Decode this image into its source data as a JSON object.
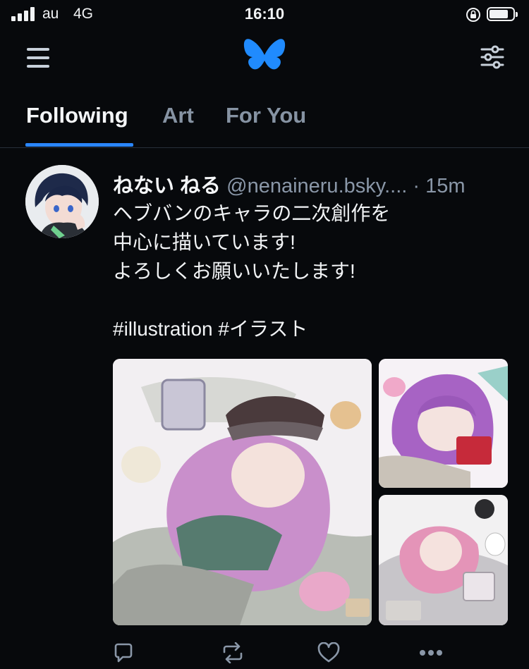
{
  "status_bar": {
    "carrier": "au",
    "network": "4G",
    "time": "16:10"
  },
  "header": {
    "logo_icon": "butterfly-logo-icon",
    "brand_color": "#208bfe"
  },
  "tabs": [
    {
      "label": "Following",
      "active": true
    },
    {
      "label": "Art",
      "active": false
    },
    {
      "label": "For You",
      "active": false
    }
  ],
  "post": {
    "author": "ねない ねる",
    "handle": "@nenaineru.bsky....",
    "separator": "·",
    "time": "15m",
    "text_lines": [
      "ヘブバンのキャラの二次創作を",
      "中心に描いています!",
      "よろしくお願いいたします!",
      "",
      "#illustration #イラスト"
    ],
    "images": [
      {
        "name": "artwork-main"
      },
      {
        "name": "artwork-top-right"
      },
      {
        "name": "artwork-bottom-right"
      }
    ]
  },
  "actions": {
    "icons": [
      "reply-icon",
      "repost-icon",
      "like-icon",
      "more-icon"
    ]
  }
}
